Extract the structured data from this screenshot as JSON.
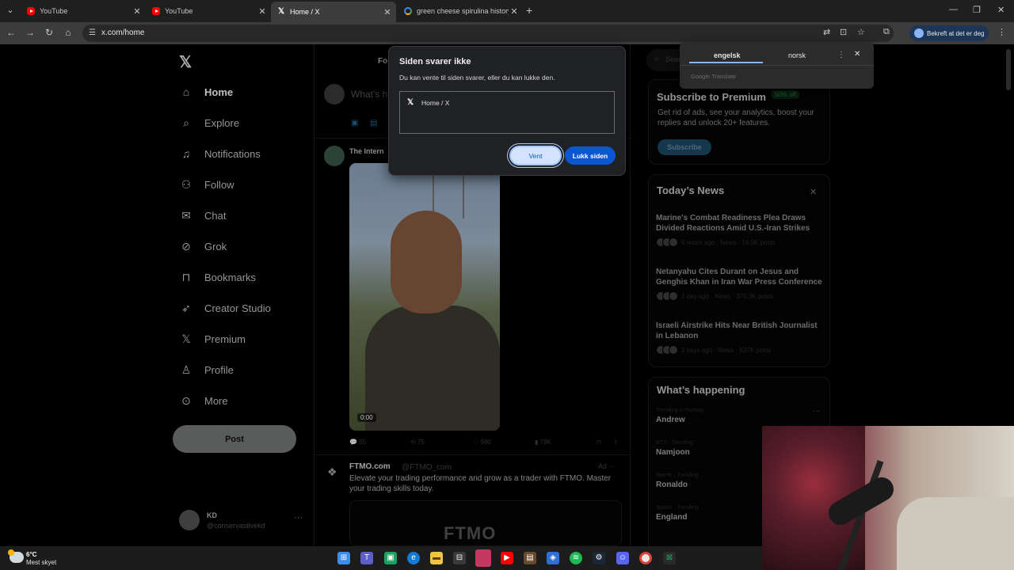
{
  "browser": {
    "tabs": [
      {
        "title": "YouTube",
        "favicon": "youtube-icon",
        "active": false
      },
      {
        "title": "YouTube",
        "favicon": "youtube-icon",
        "active": false
      },
      {
        "title": "Home / X",
        "favicon": "x-icon",
        "active": true
      },
      {
        "title": "green cheese spirulina history",
        "favicon": "google-icon",
        "active": false
      }
    ],
    "url": "x.com/home",
    "profile_label": "Bekreft at det er deg"
  },
  "sidebar": {
    "items": [
      {
        "label": "Home",
        "icon": "home-icon",
        "active": true
      },
      {
        "label": "Explore",
        "icon": "search-icon"
      },
      {
        "label": "Notifications",
        "icon": "bell-icon"
      },
      {
        "label": "Follow",
        "icon": "add-person-icon"
      },
      {
        "label": "Chat",
        "icon": "mail-icon"
      },
      {
        "label": "Grok",
        "icon": "grok-icon"
      },
      {
        "label": "Bookmarks",
        "icon": "bookmark-icon"
      },
      {
        "label": "Creator Studio",
        "icon": "rocket-icon"
      },
      {
        "label": "Premium",
        "icon": "x-icon"
      },
      {
        "label": "Profile",
        "icon": "person-icon"
      },
      {
        "label": "More",
        "icon": "more-circle-icon"
      }
    ],
    "post_label": "Post",
    "account": {
      "name": "KD",
      "handle": "@conservastivekd"
    }
  },
  "timeline": {
    "tab_label": "Fo",
    "compose_placeholder": "What's h",
    "tweet": {
      "author": "The Intern",
      "video_time": "0:00",
      "stats": {
        "replies": "55",
        "reposts": "75",
        "likes": "980",
        "views": "78K"
      }
    },
    "ad": {
      "name": "FTMO.com",
      "handle": "@FTMO_com",
      "label": "Ad",
      "text": "Elevate your trading performance and grow as a trader with FTMO. Master your trading skills today.",
      "card_brand": "FTMO"
    }
  },
  "right": {
    "search_placeholder": "Sear",
    "premium": {
      "title": "Subscribe to Premium",
      "badge": "50% off",
      "text": "Get rid of ads, see your analytics, boost your replies and unlock 20+ features.",
      "button": "Subscribe"
    },
    "news": {
      "title": "Today’s News",
      "items": [
        {
          "headline": "Marine's Combat Readiness Plea Draws Divided Reactions Amid U.S.-Iran Strikes",
          "meta": "6 hours ago · News · 16.9K posts"
        },
        {
          "headline": "Netanyahu Cites Durant on Jesus and Genghis Khan in Iran War Press Conference",
          "meta": "1 day ago · News · 376.3K posts"
        },
        {
          "headline": "Israeli Airstrike Hits Near British Journalist in Lebanon",
          "meta": "2 days ago · News · 637K posts"
        }
      ]
    },
    "happening": {
      "title": "What’s happening",
      "trends": [
        {
          "meta": "Trending in Norway",
          "name": "Andrew"
        },
        {
          "meta": "BTS · Trending",
          "name": "Namjoon"
        },
        {
          "meta": "Sports · Trending",
          "name": "Ronaldo"
        },
        {
          "meta": "Sports · Trending",
          "name": "England"
        }
      ]
    }
  },
  "dialog": {
    "title": "Siden svarer ikke",
    "message": "Du kan vente til siden svarer, eller du kan lukke den.",
    "page_item": "Home / X",
    "wait_label": "Vent",
    "close_label": "Lukk siden"
  },
  "translate": {
    "source_lang": "engelsk",
    "target_lang": "norsk",
    "brand": "Google Translate"
  },
  "taskbar": {
    "temperature": "6°C",
    "condition": "Mest skyet"
  }
}
